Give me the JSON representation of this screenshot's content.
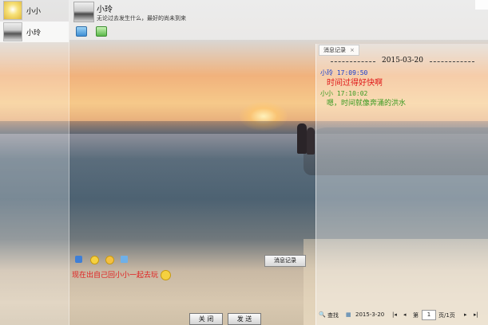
{
  "contacts": [
    {
      "name": "小小",
      "active": false
    },
    {
      "name": "小玲",
      "active": true
    }
  ],
  "header": {
    "name": "小玲",
    "signature": "无论过去发生什么，最好的尚未到来"
  },
  "history": {
    "tab_label": "消息记录",
    "tab_close": "×",
    "date": "2015-03-20",
    "messages": [
      {
        "sender": "小玲",
        "time": "17:09:50",
        "text": "时间过得好快啊",
        "header_color": "#1a3fcc",
        "text_color": "#e01818"
      },
      {
        "sender": "小小",
        "time": "17:10:02",
        "text": "嗯，时间就像奔涌的洪水",
        "header_color": "#3a9a22",
        "text_color": "#3a9a22"
      }
    ],
    "footer": {
      "search": "查找",
      "date": "2015-3-20",
      "page_prefix": "第",
      "page": "1",
      "page_suffix": "页/1页"
    }
  },
  "compose": {
    "draft": "现在出自己回小小一起去玩"
  },
  "buttons": {
    "history": "消息记录",
    "close": "关 闭",
    "send": "发 送"
  }
}
